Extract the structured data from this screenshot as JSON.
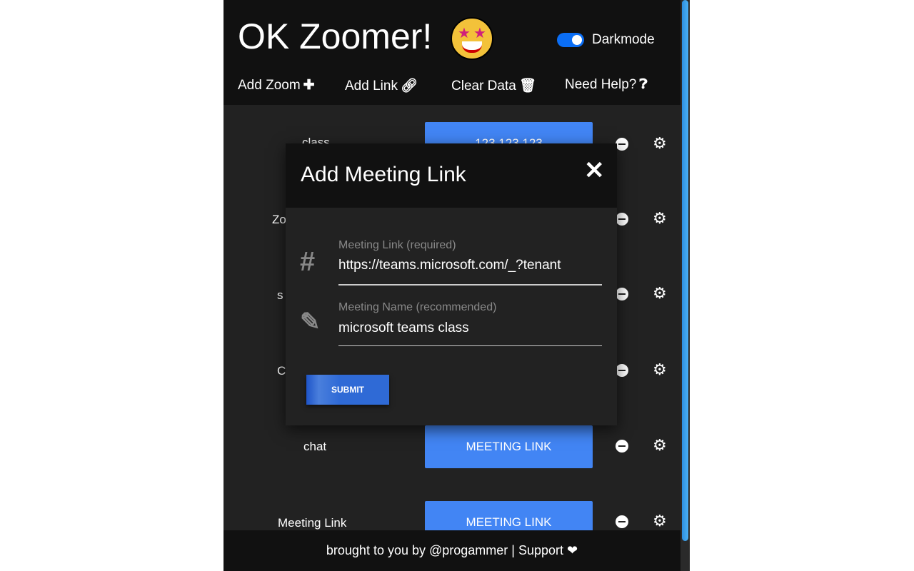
{
  "header": {
    "title": "OK Zoomer!",
    "emoji": "star-struck-emoji",
    "darkmode_label": "Darkmode",
    "darkmode_on": true
  },
  "nav": [
    {
      "label": "Add Zoom",
      "icon": "plus-icon"
    },
    {
      "label": "Add Link",
      "icon": "link-icon"
    },
    {
      "label": "Clear Data",
      "icon": "trash-icon"
    },
    {
      "label": "Need Help?",
      "icon": "question-icon"
    }
  ],
  "rows": [
    {
      "label": "class",
      "button": "123 123 123"
    },
    {
      "label": "Zo"
    },
    {
      "label": "s"
    },
    {
      "label": "C"
    },
    {
      "label": "chat",
      "button": "MEETING LINK"
    },
    {
      "label": "Meeting Link",
      "button": "MEETING LINK"
    }
  ],
  "footer": "brought to you by @progammer | Support ❤",
  "modal": {
    "title": "Add Meeting Link",
    "link_label": "Meeting Link (required)",
    "link_value": "https://teams.microsoft.com/_?tenant",
    "name_label": "Meeting Name (recommended)",
    "name_value": "microsoft teams class",
    "submit": "SUBMIT"
  },
  "colors": {
    "accent": "#4285f4",
    "toggle": "#0b6ef5",
    "header_bg": "#111111",
    "body_bg": "#222222"
  }
}
